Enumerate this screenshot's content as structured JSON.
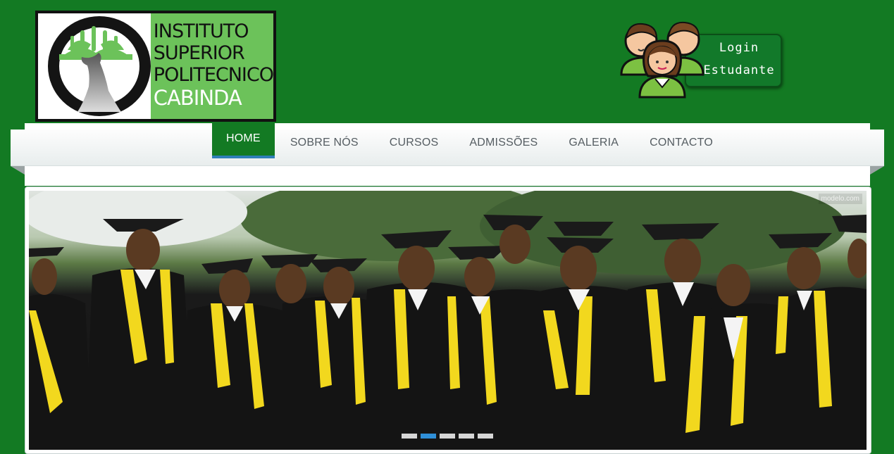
{
  "logo": {
    "line1": "INSTITUTO",
    "line2": "SUPERIOR",
    "line3": "POLITECNICO",
    "line4": "CABINDA"
  },
  "login": {
    "line1": "Login",
    "line2": "Estudante"
  },
  "nav": {
    "items": [
      {
        "label": "HOME",
        "active": true
      },
      {
        "label": "SOBRE NÓS"
      },
      {
        "label": "CURSOS"
      },
      {
        "label": "ADMISSÕES"
      },
      {
        "label": "GALERIA"
      },
      {
        "label": "CONTACTO"
      }
    ]
  },
  "slider": {
    "image": "graduates-group-photo",
    "watermark": "modelo.com",
    "slide_count": 5,
    "active_slide": 2
  },
  "colors": {
    "brand_green": "#137a23",
    "logo_green": "#6cc25a",
    "active_accent": "#2f7fb8",
    "dot_active": "#2f8fd8"
  }
}
